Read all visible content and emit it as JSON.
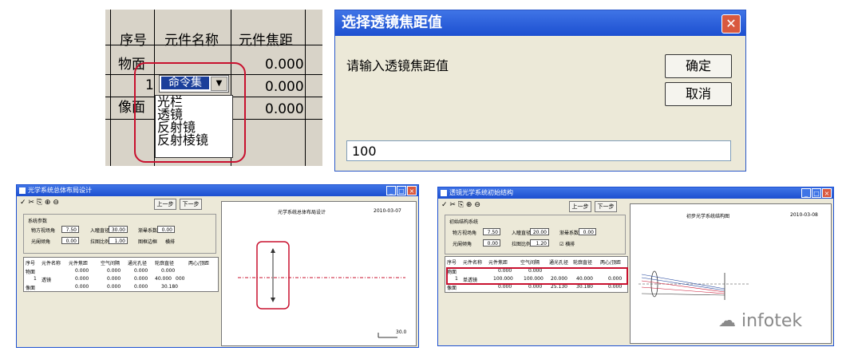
{
  "table_zoom": {
    "headers": [
      "序号",
      "元件名称",
      "元件焦距"
    ],
    "rows": [
      {
        "index": "物面",
        "name": "",
        "focal": "0.000"
      },
      {
        "index": "1",
        "name": "命令集",
        "focal": "0.000"
      },
      {
        "index": "像面",
        "name": "",
        "focal": "0.000"
      }
    ],
    "dropdown_options": [
      "光栏",
      "透镜",
      "反射镜",
      "反射棱镜"
    ]
  },
  "dialog": {
    "title": "选择透镜焦距值",
    "prompt": "请输入透镜焦距值",
    "ok": "确定",
    "cancel": "取消",
    "input_value": "100"
  },
  "win_left": {
    "title": "光学系统总体布局设计",
    "prev": "上一步",
    "next": "下一步",
    "group_title": "系统参数",
    "fields": [
      {
        "label": "物方视场角",
        "value": "7.50"
      },
      {
        "label": "入瞳直径",
        "value": "30.00"
      },
      {
        "label": "渐晕系数",
        "value": "0.00"
      },
      {
        "label": "光阑倾角",
        "value": "0.00"
      },
      {
        "label": "拉图比例",
        "value": "1.00"
      },
      {
        "label": "图框边框",
        "value": ""
      },
      {
        "label": "横排",
        "value": ""
      }
    ],
    "columns": [
      "序号",
      "元件名称",
      "元件焦距",
      "空气间隔",
      "通光孔径",
      "轮廓直径",
      "两心/顶距"
    ],
    "rows": [
      [
        "物面",
        "",
        "0.000",
        "0.000",
        "0.000",
        "0.000",
        ""
      ],
      [
        "1",
        "透镜",
        "0.000",
        "0.000",
        "0.000",
        "40.000",
        "000"
      ],
      [
        "像面",
        "",
        "0.000",
        "0.000",
        "0.000",
        "30.180",
        ""
      ]
    ],
    "canvas_title": "光学系统总体布局设计",
    "canvas_date": "2010-03-07",
    "scale_label": "30.0"
  },
  "win_right": {
    "title": "透镜光学系统初始结构",
    "prev": "上一步",
    "next": "下一步",
    "group_title": "初始结构系统",
    "fields": [
      {
        "label": "物方视场角",
        "value": "7.50"
      },
      {
        "label": "入瞳直径",
        "value": "20.00"
      },
      {
        "label": "渐晕系数",
        "value": "0.00"
      },
      {
        "label": "光阑倾角",
        "value": "0.00"
      },
      {
        "label": "拉图比例",
        "value": "1.20"
      },
      {
        "label": "横排",
        "value": ""
      }
    ],
    "columns": [
      "序号",
      "元件名称",
      "元件焦距",
      "空气间隔",
      "通光孔径",
      "轮廓直径",
      "两心/顶距"
    ],
    "rows": [
      [
        "物面",
        "",
        "0.000",
        "0.000",
        "",
        "",
        ""
      ],
      [
        "1",
        "单透镜",
        "100.000",
        "100.000",
        "20.000",
        "40.000",
        "0.000"
      ],
      [
        "像面",
        "",
        "0.000",
        "0.000",
        "25.130",
        "30.180",
        "0.000"
      ]
    ],
    "canvas_title": "初步光学系统结构图",
    "canvas_date": "2010-03-08"
  },
  "watermark": "infotek",
  "colors": {
    "highlight": "#c8102e",
    "titlebar": "#1c4fd0",
    "selection": "#1b3f9a"
  }
}
